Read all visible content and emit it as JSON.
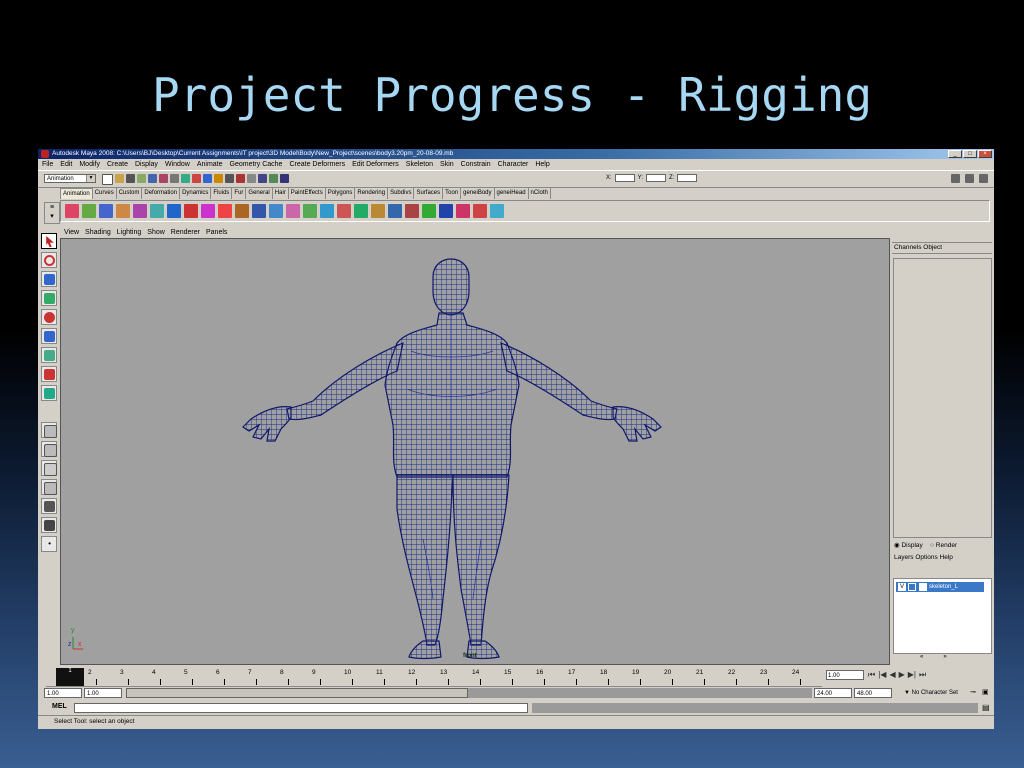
{
  "slide": {
    "title": "Project Progress - Rigging"
  },
  "window": {
    "title": "Autodesk Maya 2008: C:\\Users\\BJ\\Desktop\\Current Assignments\\IT project\\3D Model\\Body\\New_Project\\scenes\\body3.20pm_20-08-09.mb"
  },
  "menubar": [
    "File",
    "Edit",
    "Modify",
    "Create",
    "Display",
    "Window",
    "Animate",
    "Geometry Cache",
    "Create Deformers",
    "Edit Deformers",
    "Skeleton",
    "Skin",
    "Constrain",
    "Character",
    "Help"
  ],
  "status_line": {
    "mode": "Animation",
    "x_label": "X:",
    "y_label": "Y:",
    "z_label": "Z:"
  },
  "shelf_tabs": [
    "Animation",
    "Curves",
    "Custom",
    "Deformation",
    "Dynamics",
    "Fluids",
    "Fur",
    "General",
    "Hair",
    "PaintEffects",
    "Polygons",
    "Rendering",
    "Subdivs",
    "Surfaces",
    "Toon",
    "geneiBody",
    "geneiHead",
    "nCloth"
  ],
  "panel_menu": [
    "View",
    "Shading",
    "Lighting",
    "Show",
    "Renderer",
    "Panels"
  ],
  "viewport": {
    "camera": "front",
    "axis_y": "y",
    "axis_z": "z",
    "axis_x": "x"
  },
  "channel_box": {
    "tabs": "Channels   Object"
  },
  "layer_editor": {
    "display_label": "Display",
    "render_label": "Render",
    "menu": "Layers   Options   Help",
    "layer_visible": "V",
    "layer_name": "skeleton_L"
  },
  "time_slider": {
    "current": "1",
    "ticks": [
      "2",
      "3",
      "4",
      "5",
      "6",
      "7",
      "8",
      "9",
      "10",
      "11",
      "12",
      "13",
      "14",
      "15",
      "16",
      "17",
      "18",
      "19",
      "20",
      "21",
      "22",
      "23",
      "24"
    ],
    "current_frame": "1.00"
  },
  "range_slider": {
    "start_time": "1.00",
    "playback_start": "1.00",
    "playback_end": "24.00",
    "end_time": "48.00",
    "character_set": "No Character Set"
  },
  "command_line": {
    "label": "MEL"
  },
  "help_line": {
    "text": "Select Tool: select an object"
  },
  "colors": {
    "mesh": "#1a2a8c",
    "viewport": "#a0a0a0",
    "title_text": "#a6d8f4"
  }
}
